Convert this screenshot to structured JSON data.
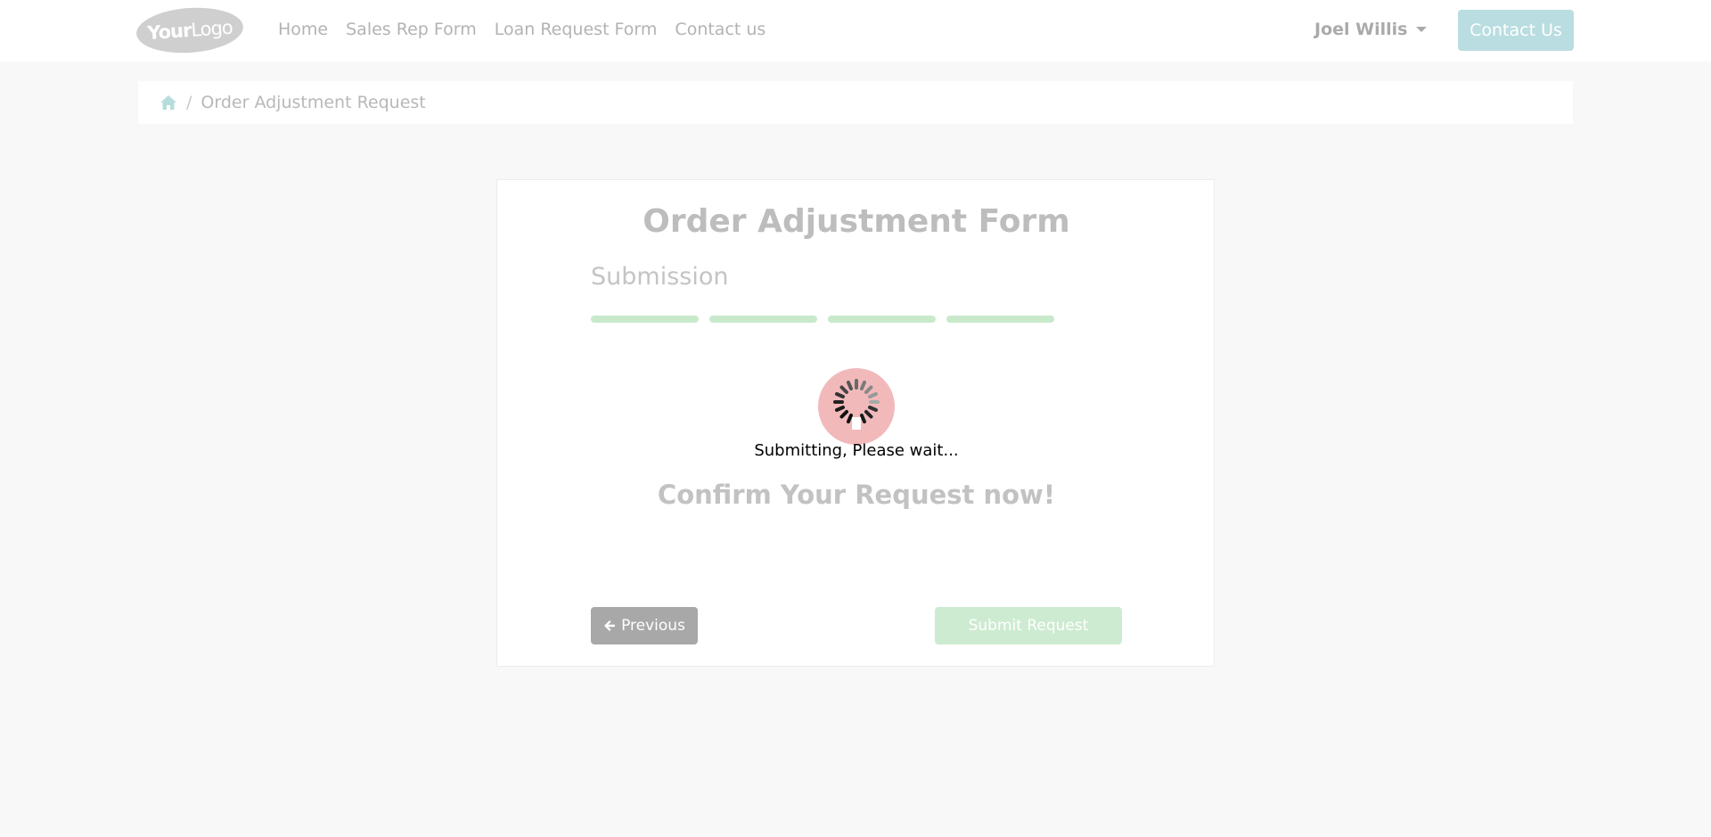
{
  "navbar": {
    "logo": {
      "bold": "Your",
      "light": "Logo"
    },
    "links": [
      "Home",
      "Sales Rep Form",
      "Loan Request Form",
      "Contact us"
    ],
    "user_name": "Joel Willis",
    "contact_button": "Contact Us"
  },
  "breadcrumb": {
    "home_icon": "home-icon",
    "current": "Order Adjustment Request"
  },
  "form": {
    "title": "Order Adjustment Form",
    "step_title": "Submission",
    "progress_steps": 4,
    "progress_completed": 4,
    "loading_text": "Submitting, Please wait...",
    "confirm_text": "Confirm Your Request now!",
    "previous_button": "Previous",
    "submit_button": "Submit Request"
  },
  "colors": {
    "accent_teal": "#b9dde0",
    "progress_green": "#c9e9cb",
    "spinner_bg": "#f2b9bb"
  }
}
